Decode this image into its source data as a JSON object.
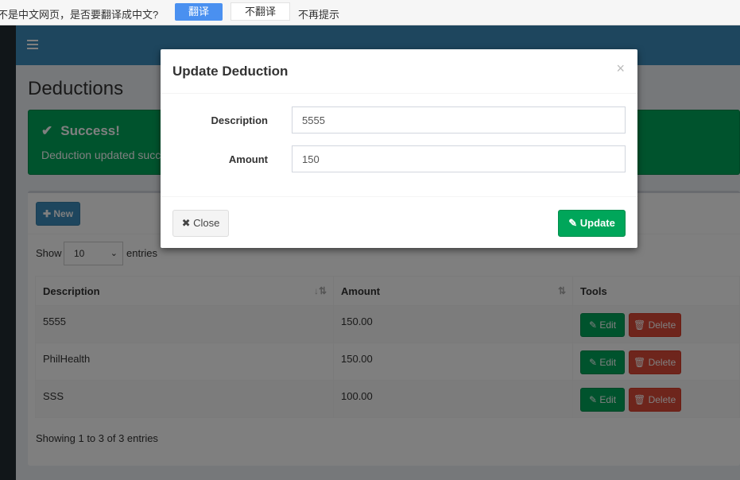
{
  "translate_bar": {
    "prompt": "不是中文网页，是否要翻译成中文?",
    "translate": "翻译",
    "no_translate": "不翻译",
    "never": "不再提示"
  },
  "colors": {
    "navbar": "#3c8dbc",
    "success": "#00a65a",
    "danger": "#dd4b39",
    "primary": "#3c8dbc"
  },
  "page": {
    "title": "Deductions"
  },
  "alert": {
    "icon": "check-icon",
    "heading": "Success!",
    "message": "Deduction updated succes"
  },
  "toolbar": {
    "new_label": "New",
    "new_icon": "plus-icon"
  },
  "length_menu": {
    "show": "Show",
    "selected": "10",
    "entries": "entries"
  },
  "table": {
    "columns": [
      "Description",
      "Amount",
      "Tools"
    ],
    "rows": [
      {
        "description": "5555",
        "amount": "150.00"
      },
      {
        "description": "PhilHealth",
        "amount": "150.00"
      },
      {
        "description": "SSS",
        "amount": "100.00"
      }
    ],
    "edit_label": "Edit",
    "delete_label": "Delete",
    "info": "Showing 1 to 3 of 3 entries"
  },
  "modal": {
    "title": "Update Deduction",
    "close_glyph": "×",
    "description_label": "Description",
    "description_value": "5555",
    "amount_label": "Amount",
    "amount_value": "150",
    "close_button": "Close",
    "update_button": "Update"
  }
}
